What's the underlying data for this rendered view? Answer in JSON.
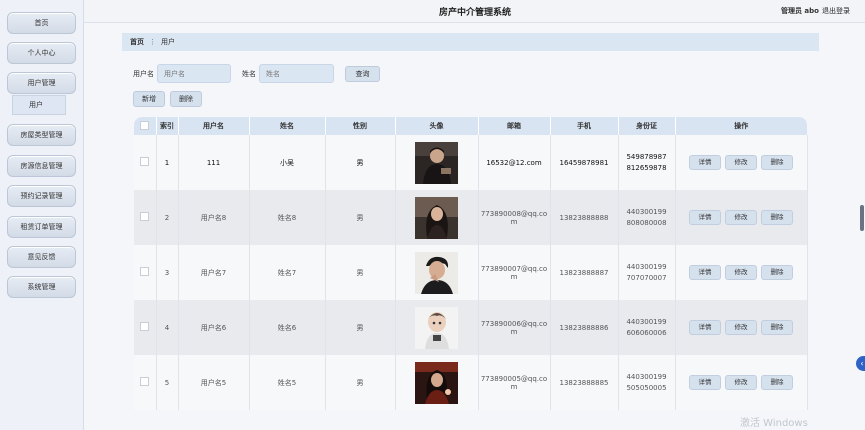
{
  "app_title": "房产中介管理系统",
  "header": {
    "admin_label": "管理员 abo",
    "logout": "退出登录"
  },
  "sidebar": {
    "items": [
      "首页",
      "个人中心",
      "用户管理",
      "房屋类型管理",
      "房源信息管理",
      "预约记录管理",
      "租赁订单管理",
      "意见反馈",
      "系统管理"
    ],
    "sub_items": [
      "用户"
    ]
  },
  "breadcrumb": {
    "home": "首页",
    "current": "用户"
  },
  "search": {
    "username_label": "用户名",
    "username_placeholder": "用户名",
    "name_label": "姓名",
    "name_placeholder": "姓名",
    "query_button": "查询"
  },
  "toolbar": {
    "add": "新增",
    "delete": "删除"
  },
  "table": {
    "headers": [
      "",
      "索引",
      "用户名",
      "姓名",
      "性别",
      "头像",
      "邮箱",
      "手机",
      "身份证",
      "操作"
    ],
    "rows": [
      {
        "index": "1",
        "username": "111",
        "name": "小吴",
        "gender": "男",
        "email": "16532@12.com",
        "phone": "16459878981",
        "id_card": "549878987812659878",
        "avatar": "avatar-man-dark"
      },
      {
        "index": "2",
        "username": "用户名8",
        "name": "姓名8",
        "gender": "男",
        "email": "773890008@qq.com",
        "phone": "13823888888",
        "id_card": "440300199808080008",
        "avatar": "avatar-woman-dark"
      },
      {
        "index": "3",
        "username": "用户名7",
        "name": "姓名7",
        "gender": "男",
        "email": "773890007@qq.com",
        "phone": "13823888887",
        "id_card": "440300199707070007",
        "avatar": "avatar-man-light"
      },
      {
        "index": "4",
        "username": "用户名6",
        "name": "姓名6",
        "gender": "男",
        "email": "773890006@qq.com",
        "phone": "13823888886",
        "id_card": "440300199606060006",
        "avatar": "avatar-cartoon"
      },
      {
        "index": "5",
        "username": "用户名5",
        "name": "姓名5",
        "gender": "男",
        "email": "773890005@qq.com",
        "phone": "13823888885",
        "id_card": "440300199505050005",
        "avatar": "avatar-woman-neon"
      }
    ],
    "actions": {
      "detail": "详情",
      "edit": "修改",
      "delete": "删除"
    }
  },
  "watermark": "激活 Windows",
  "colors": {
    "accent": "#d8e4f2",
    "sidebar_bg": "#eef2f8",
    "float_button": "#2f62c8"
  }
}
